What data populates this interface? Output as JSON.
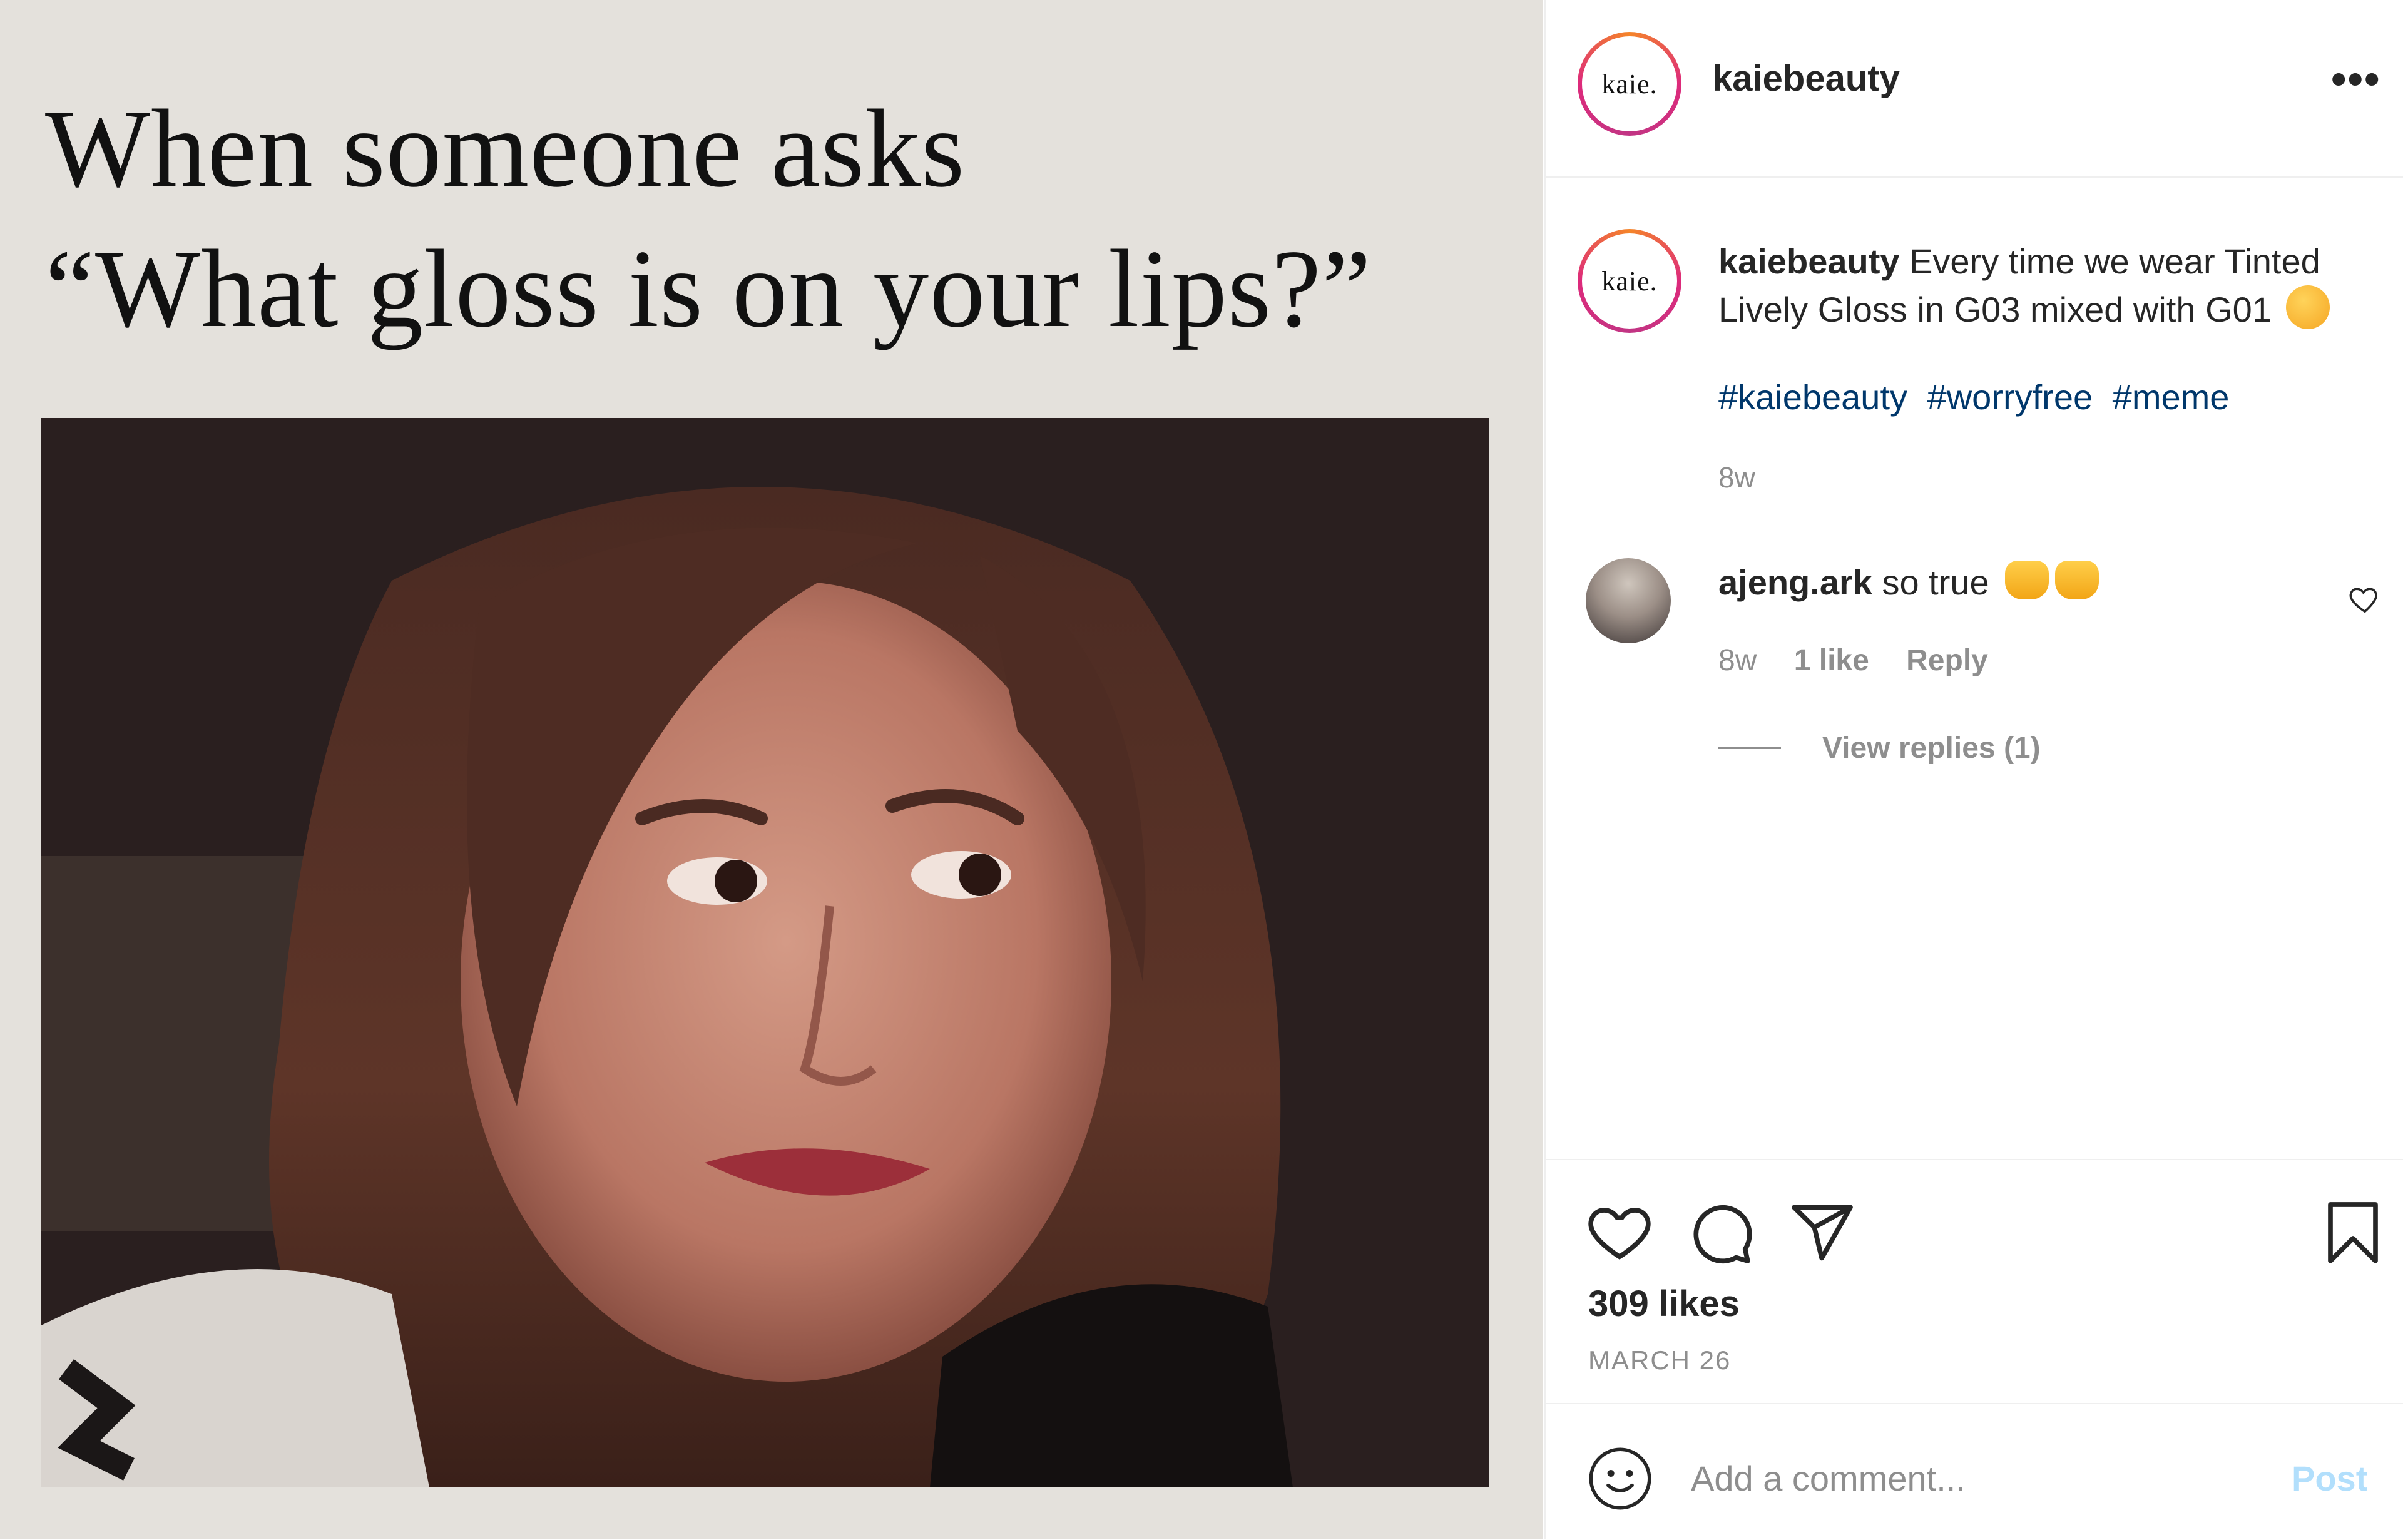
{
  "media": {
    "headline_line1": "When someone asks",
    "headline_line2": "“What gloss is on your lips?”",
    "background_color": "#e4e1dc"
  },
  "header": {
    "username": "kaiebeauty",
    "avatar_logo": "kaie.",
    "more_label": "•••"
  },
  "caption": {
    "username": "kaiebeauty",
    "text": "Every time we wear Tinted Lively Gloss in G03 mixed with G01",
    "emoji": "smiling-face-with-hearts",
    "hashtags": [
      "#kaiebeauty",
      "#worryfree",
      "#meme"
    ],
    "time": "8w"
  },
  "comment": {
    "username": "ajeng.ark",
    "text": "so true",
    "emoji": "raising-hands x2",
    "time": "8w",
    "likes": "1 like",
    "reply_label": "Reply",
    "view_replies": "View replies (1)"
  },
  "actions": {
    "likes": "309 likes",
    "date": "MARCH 26",
    "icons": [
      "heart-icon",
      "comment-icon",
      "share-icon",
      "bookmark-icon"
    ]
  },
  "add_comment": {
    "placeholder": "Add a comment...",
    "post_label": "Post"
  },
  "colors": {
    "link": "#00376b",
    "muted": "#8e8e8e",
    "post_disabled": "#b2dffc"
  }
}
